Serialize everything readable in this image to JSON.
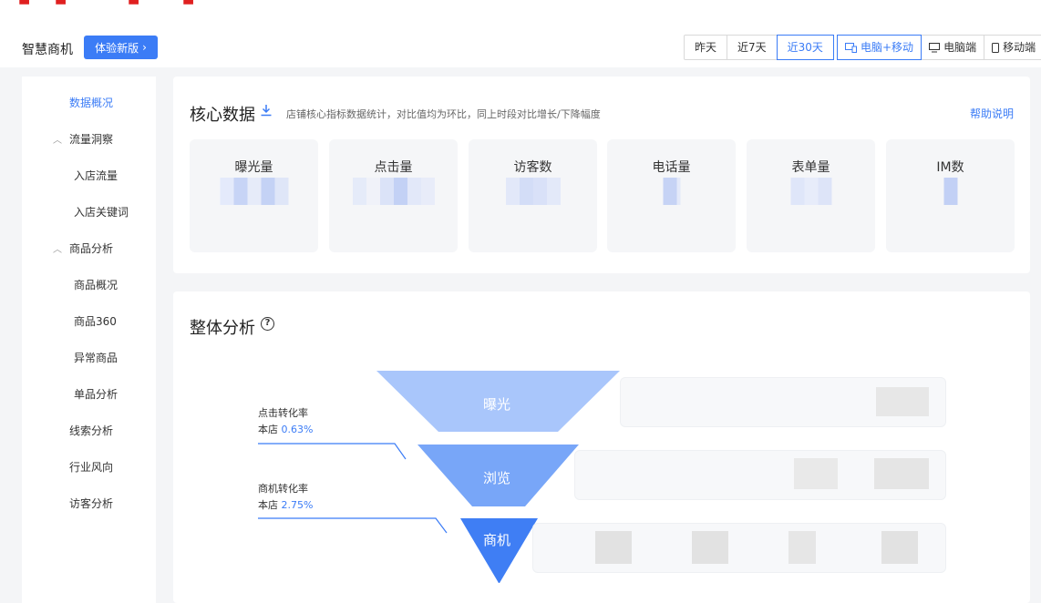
{
  "header": {
    "brand": "智慧商机",
    "try_button": "体验新版",
    "try_chevron": "›",
    "date_ranges": [
      "昨天",
      "近7天",
      "近30天"
    ],
    "date_range_selected": "近30天",
    "devices": [
      {
        "label": "电脑+移动",
        "icon": "desktop-mobile-icon",
        "active": true
      },
      {
        "label": "电脑端",
        "icon": "desktop-icon",
        "active": false
      },
      {
        "label": "移动端",
        "icon": "mobile-icon",
        "active": false
      }
    ]
  },
  "sidebar": {
    "items": [
      {
        "label": "数据概况",
        "type": "item",
        "active": true
      },
      {
        "label": "流量洞察",
        "type": "group"
      },
      {
        "label": "入店流量",
        "type": "subitem"
      },
      {
        "label": "入店关键词",
        "type": "subitem"
      },
      {
        "label": "商品分析",
        "type": "group"
      },
      {
        "label": "商品概况",
        "type": "subitem"
      },
      {
        "label": "商品360",
        "type": "subitem"
      },
      {
        "label": "异常商品",
        "type": "subitem"
      },
      {
        "label": "单品分析",
        "type": "subitem"
      },
      {
        "label": "线索分析",
        "type": "item"
      },
      {
        "label": "行业风向",
        "type": "item"
      },
      {
        "label": "访客分析",
        "type": "item"
      }
    ]
  },
  "core": {
    "title": "核心数据",
    "subtitle": "店铺核心指标数据统计，对比值均为环比，同上时段对比增长/下降幅度",
    "help": "帮助说明",
    "metrics": [
      "曝光量",
      "点击量",
      "访客数",
      "电话量",
      "表单量",
      "IM数"
    ]
  },
  "overall": {
    "title": "整体分析",
    "funnel": [
      "曝光",
      "浏览",
      "商机"
    ],
    "rates": [
      {
        "name": "点击转化率",
        "prefix": "本店 ",
        "value": "0.63%"
      },
      {
        "name": "商机转化率",
        "prefix": "本店 ",
        "value": "2.75%"
      }
    ]
  },
  "colors": {
    "accent": "#3b7cf6",
    "funnel_top": "#a9c6fb",
    "funnel_mid": "#78a6f8",
    "funnel_bottom": "#3f7ef4"
  }
}
